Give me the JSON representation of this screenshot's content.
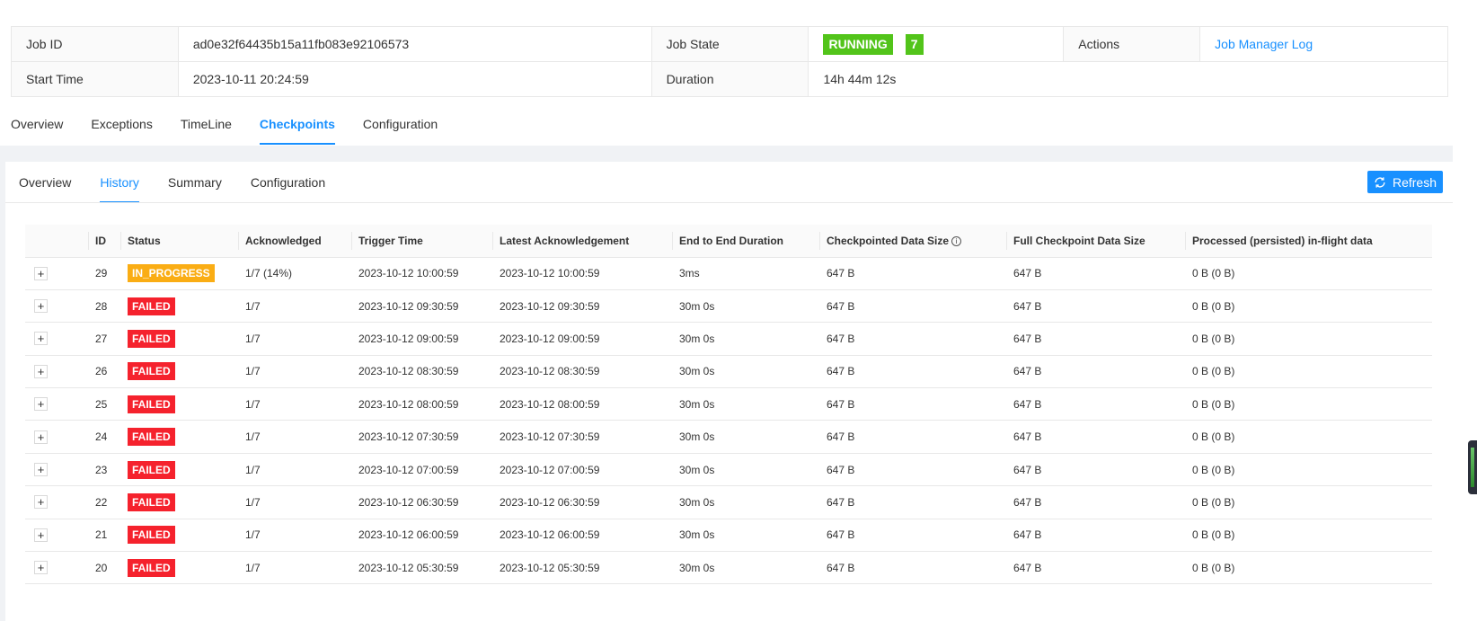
{
  "job": {
    "id_label": "Job ID",
    "id_value": "ad0e32f64435b15a11fb083e92106573",
    "state_label": "Job State",
    "state_value": "RUNNING",
    "state_count": "7",
    "actions_label": "Actions",
    "actions_link": "Job Manager Log",
    "start_label": "Start Time",
    "start_value": "2023-10-11 20:24:59",
    "duration_label": "Duration",
    "duration_value": "14h 44m 12s"
  },
  "main_tabs": [
    "Overview",
    "Exceptions",
    "TimeLine",
    "Checkpoints",
    "Configuration"
  ],
  "sub_tabs": [
    "Overview",
    "History",
    "Summary",
    "Configuration"
  ],
  "refresh_label": "Refresh",
  "history": {
    "headers": [
      "ID",
      "Status",
      "Acknowledged",
      "Trigger Time",
      "Latest Acknowledgement",
      "End to End Duration",
      "Checkpointed Data Size",
      "Full Checkpoint Data Size",
      "Processed (persisted) in-flight data"
    ],
    "rows": [
      {
        "expand": "+",
        "id": "29",
        "status": "IN_PROGRESS",
        "ack": "1/7 (14%)",
        "trigger": "2023-10-12 10:00:59",
        "latest": "2023-10-12 10:00:59",
        "e2e": "3ms",
        "cds": "647 B",
        "full": "647 B",
        "proc": "0 B (0 B)"
      },
      {
        "expand": "+",
        "id": "28",
        "status": "FAILED",
        "ack": "1/7",
        "trigger": "2023-10-12 09:30:59",
        "latest": "2023-10-12 09:30:59",
        "e2e": "30m 0s",
        "cds": "647 B",
        "full": "647 B",
        "proc": "0 B (0 B)"
      },
      {
        "expand": "+",
        "id": "27",
        "status": "FAILED",
        "ack": "1/7",
        "trigger": "2023-10-12 09:00:59",
        "latest": "2023-10-12 09:00:59",
        "e2e": "30m 0s",
        "cds": "647 B",
        "full": "647 B",
        "proc": "0 B (0 B)"
      },
      {
        "expand": "+",
        "id": "26",
        "status": "FAILED",
        "ack": "1/7",
        "trigger": "2023-10-12 08:30:59",
        "latest": "2023-10-12 08:30:59",
        "e2e": "30m 0s",
        "cds": "647 B",
        "full": "647 B",
        "proc": "0 B (0 B)"
      },
      {
        "expand": "+",
        "id": "25",
        "status": "FAILED",
        "ack": "1/7",
        "trigger": "2023-10-12 08:00:59",
        "latest": "2023-10-12 08:00:59",
        "e2e": "30m 0s",
        "cds": "647 B",
        "full": "647 B",
        "proc": "0 B (0 B)"
      },
      {
        "expand": "+",
        "id": "24",
        "status": "FAILED",
        "ack": "1/7",
        "trigger": "2023-10-12 07:30:59",
        "latest": "2023-10-12 07:30:59",
        "e2e": "30m 0s",
        "cds": "647 B",
        "full": "647 B",
        "proc": "0 B (0 B)"
      },
      {
        "expand": "+",
        "id": "23",
        "status": "FAILED",
        "ack": "1/7",
        "trigger": "2023-10-12 07:00:59",
        "latest": "2023-10-12 07:00:59",
        "e2e": "30m 0s",
        "cds": "647 B",
        "full": "647 B",
        "proc": "0 B (0 B)"
      },
      {
        "expand": "+",
        "id": "22",
        "status": "FAILED",
        "ack": "1/7",
        "trigger": "2023-10-12 06:30:59",
        "latest": "2023-10-12 06:30:59",
        "e2e": "30m 0s",
        "cds": "647 B",
        "full": "647 B",
        "proc": "0 B (0 B)"
      },
      {
        "expand": "+",
        "id": "21",
        "status": "FAILED",
        "ack": "1/7",
        "trigger": "2023-10-12 06:00:59",
        "latest": "2023-10-12 06:00:59",
        "e2e": "30m 0s",
        "cds": "647 B",
        "full": "647 B",
        "proc": "0 B (0 B)"
      },
      {
        "expand": "+",
        "id": "20",
        "status": "FAILED",
        "ack": "1/7",
        "trigger": "2023-10-12 05:30:59",
        "latest": "2023-10-12 05:30:59",
        "e2e": "30m 0s",
        "cds": "647 B",
        "full": "647 B",
        "proc": "0 B (0 B)"
      }
    ]
  },
  "colors": {
    "accent": "#1890ff",
    "running": "#52c41a",
    "failed": "#f5222d",
    "in_progress": "#faad14"
  },
  "icons": {
    "refresh": "refresh-icon",
    "info": "info-icon",
    "expand": "plus-icon"
  }
}
